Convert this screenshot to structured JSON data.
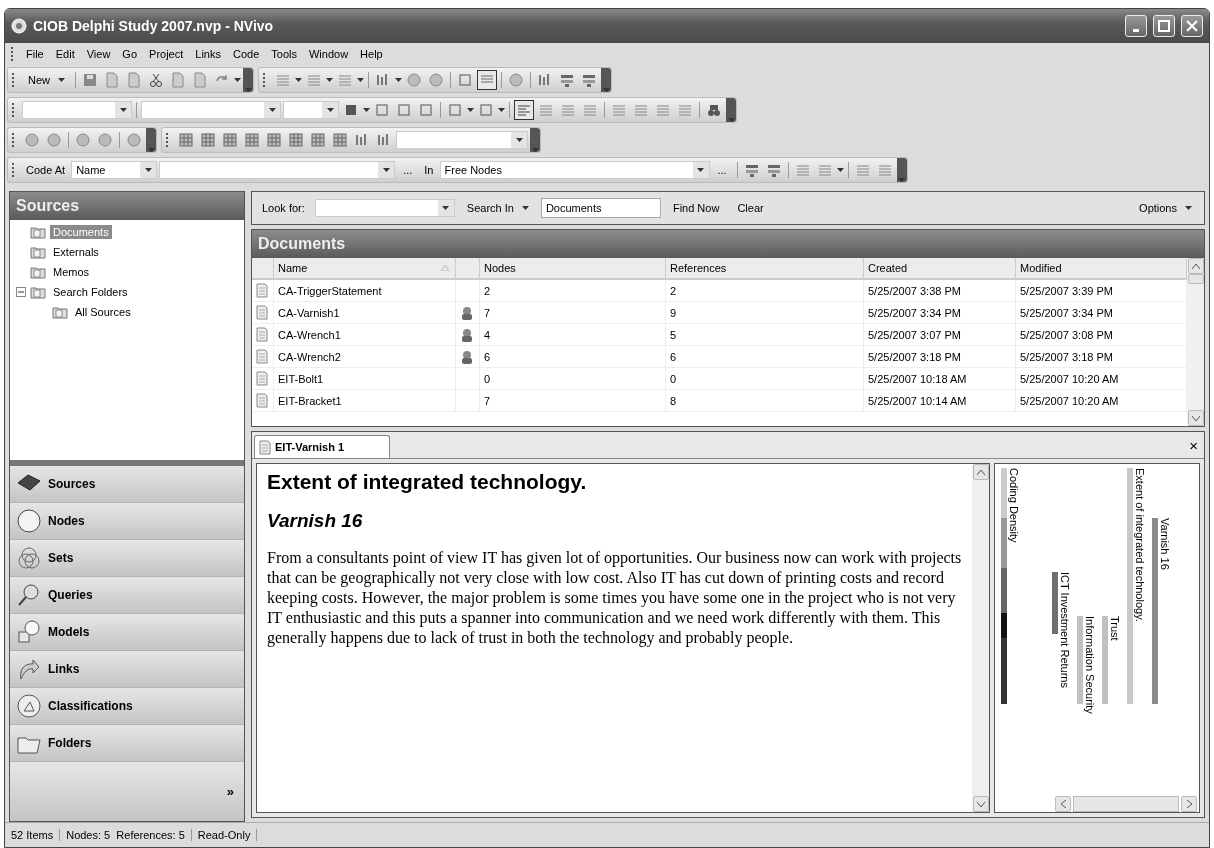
{
  "window": {
    "title": "CIOB Delphi Study 2007.nvp - NVivo"
  },
  "menu": [
    "File",
    "Edit",
    "View",
    "Go",
    "Project",
    "Links",
    "Code",
    "Tools",
    "Window",
    "Help"
  ],
  "toolbar": {
    "new_label": "New"
  },
  "code_bar": {
    "label": "Code At",
    "field": "Name",
    "browse": "...",
    "in_label": "In",
    "in_field": "Free Nodes",
    "in_browse": "..."
  },
  "sidebar": {
    "title": "Sources",
    "tree": [
      {
        "label": "Documents",
        "selected": true
      },
      {
        "label": "Externals",
        "selected": false
      },
      {
        "label": "Memos",
        "selected": false
      },
      {
        "label": "Search Folders",
        "selected": false,
        "expanded": true,
        "children": [
          {
            "label": "All Sources",
            "selected": false
          }
        ]
      }
    ],
    "nav": [
      {
        "label": "Sources",
        "kind": "sources"
      },
      {
        "label": "Nodes",
        "kind": "nodes"
      },
      {
        "label": "Sets",
        "kind": "sets"
      },
      {
        "label": "Queries",
        "kind": "queries"
      },
      {
        "label": "Models",
        "kind": "models"
      },
      {
        "label": "Links",
        "kind": "links"
      },
      {
        "label": "Classifications",
        "kind": "classifications"
      },
      {
        "label": "Folders",
        "kind": "folders"
      }
    ],
    "more": "»"
  },
  "search": {
    "look_for": "Look for:",
    "search_in": "Search In",
    "search_in_value": "Documents",
    "find_now": "Find Now",
    "clear": "Clear",
    "options": "Options"
  },
  "list": {
    "title": "Documents",
    "columns": [
      "Name",
      "Nodes",
      "References",
      "Created",
      "Modified"
    ],
    "rows": [
      {
        "name": "CA-TriggerStatement",
        "linked": false,
        "nodes": "2",
        "references": "2",
        "created": "5/25/2007 3:38 PM",
        "modified": "5/25/2007 3:39 PM"
      },
      {
        "name": "CA-Varnish1",
        "linked": true,
        "nodes": "7",
        "references": "9",
        "created": "5/25/2007 3:34 PM",
        "modified": "5/25/2007 3:34 PM"
      },
      {
        "name": "CA-Wrench1",
        "linked": true,
        "nodes": "4",
        "references": "5",
        "created": "5/25/2007 3:07 PM",
        "modified": "5/25/2007 3:08 PM"
      },
      {
        "name": "CA-Wrench2",
        "linked": true,
        "nodes": "6",
        "references": "6",
        "created": "5/25/2007 3:18 PM",
        "modified": "5/25/2007 3:18 PM"
      },
      {
        "name": "EIT-Bolt1",
        "linked": false,
        "nodes": "0",
        "references": "0",
        "created": "5/25/2007 10:18 AM",
        "modified": "5/25/2007 10:20 AM"
      },
      {
        "name": "EIT-Bracket1",
        "linked": false,
        "nodes": "7",
        "references": "8",
        "created": "5/25/2007 10:14 AM",
        "modified": "5/25/2007 10:20 AM"
      }
    ]
  },
  "tab": {
    "label": "EIT-Varnish 1",
    "close": "×"
  },
  "document": {
    "heading": "Extent of integrated technology.",
    "subheading": "Varnish 16",
    "body": "From a consultants point of view IT has given lot of opportunities.  Our business now can work with projects that can be geographically not very close with low cost. Also IT has cut down of printing costs and record keeping costs. However, the major problem is some times you have some one in the project who is not very IT enthusiastic and this puts a spanner into communication and we need work differently with them. This generally happens due to lack of trust in both the technology and probably people."
  },
  "stripes": {
    "density_label": "Coding Density",
    "items": [
      {
        "label": "ICT Investment Returns",
        "color": "#707070"
      },
      {
        "label": "Information Security",
        "color": "#c0c0c0"
      },
      {
        "label": "Trust",
        "color": "#c0c0c0"
      },
      {
        "label": "Extent of integrated technology.",
        "color": "#c8c8c8"
      },
      {
        "label": "Varnish 16",
        "color": "#8c8c8c"
      }
    ]
  },
  "status_bar": [
    "52 Items",
    "Nodes: 5  References: 5",
    "Read-Only"
  ]
}
